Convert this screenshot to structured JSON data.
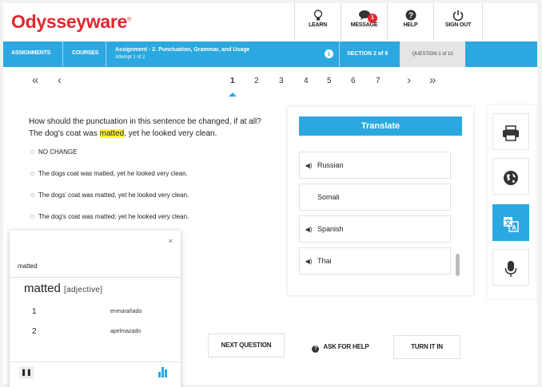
{
  "header": {
    "logo": "Odysseyware",
    "logo_mark": "®",
    "buttons": [
      {
        "label": "LEARN",
        "icon": "lightbulb-icon"
      },
      {
        "label": "MESSAGE",
        "icon": "message-icon",
        "badge": "1"
      },
      {
        "label": "HELP",
        "icon": "help-icon"
      },
      {
        "label": "SIGN OUT",
        "icon": "power-icon"
      }
    ]
  },
  "nav": {
    "assignments": "ASSIGNMENTS",
    "courses": "COURSES",
    "assignment_title": "Assignment - 2. Punctuation, Grammar, and Usage",
    "attempt": "Attempt 1 of 2",
    "section": "SECTION 2 of 6",
    "question": "QUESTION 1 of 10",
    "accent": "#2ba8e0"
  },
  "pager": {
    "first": "«",
    "prev": "‹",
    "pages": [
      "1",
      "2",
      "3",
      "4",
      "5",
      "6",
      "7"
    ],
    "current": "1",
    "next": "›",
    "last": "»"
  },
  "question": {
    "prompt": "How should the punctuation in this sentence be changed, if at all?",
    "sentence_before": "The dog's coat was ",
    "highlight": "matted",
    "sentence_after": ", yet he looked very clean.",
    "choices": [
      "NO CHANGE",
      "The dogs coat was matted, yet he looked very clean.",
      "The dogs' coat was matted, yet he looked very clean.",
      "The dog's coat was matted; yet he looked very clean."
    ]
  },
  "translate": {
    "title": "Translate",
    "languages": [
      {
        "name": "Russian",
        "audio": true
      },
      {
        "name": "Somali",
        "audio": false
      },
      {
        "name": "Spanish",
        "audio": true
      },
      {
        "name": "Thai",
        "audio": true
      }
    ]
  },
  "tools": [
    {
      "icon": "printer-icon",
      "glyph": "🖶"
    },
    {
      "icon": "globe-icon",
      "glyph": "🌐"
    },
    {
      "icon": "translate-icon",
      "glyph": "文A",
      "active": true
    },
    {
      "icon": "microphone-icon",
      "glyph": "🎙"
    }
  ],
  "dictionary": {
    "close": "×",
    "search_word": "matted",
    "headword": "matted",
    "part_of_speech": "[adjective]",
    "entries": [
      {
        "num": "1",
        "translation": "enmarañado"
      },
      {
        "num": "2",
        "translation": "apelmazado"
      }
    ],
    "pause": "❚❚"
  },
  "actions": {
    "next": "NEXT QUESTION",
    "ask": "ASK FOR HELP",
    "ask_icon": "?",
    "turn_in": "TURN IT IN"
  }
}
